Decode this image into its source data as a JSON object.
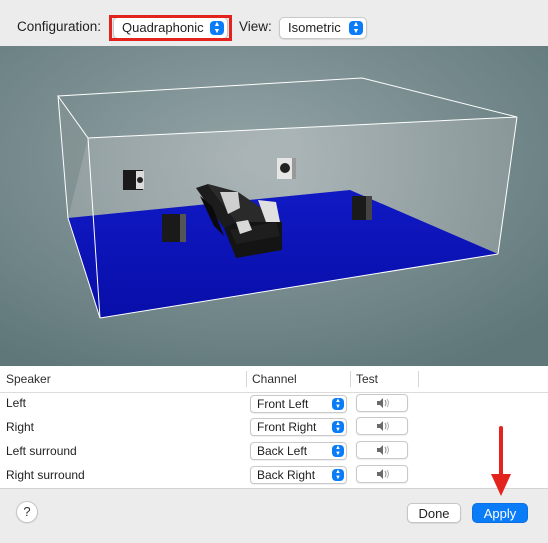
{
  "toolbar": {
    "configuration_label": "Configuration:",
    "configuration_value": "Quadraphonic",
    "view_label": "View:",
    "view_value": "Isometric"
  },
  "table": {
    "headers": {
      "speaker": "Speaker",
      "channel": "Channel",
      "test": "Test"
    },
    "rows": [
      {
        "speaker": "Left",
        "channel": "Front Left"
      },
      {
        "speaker": "Right",
        "channel": "Front Right"
      },
      {
        "speaker": "Left surround",
        "channel": "Back Left"
      },
      {
        "speaker": "Right surround",
        "channel": "Back Right"
      }
    ]
  },
  "footer": {
    "help_label": "?",
    "done_label": "Done",
    "apply_label": "Apply"
  },
  "colors": {
    "accent": "#0a7cf8",
    "annotation_red": "#e3231d",
    "floor_blue": "#0a0fb8",
    "viewport_bg": "#6f8689"
  },
  "icons": {
    "stepper": "up-down-chevron-icon",
    "test": "speaker-volume-icon",
    "annotation": "red-arrow-down"
  }
}
